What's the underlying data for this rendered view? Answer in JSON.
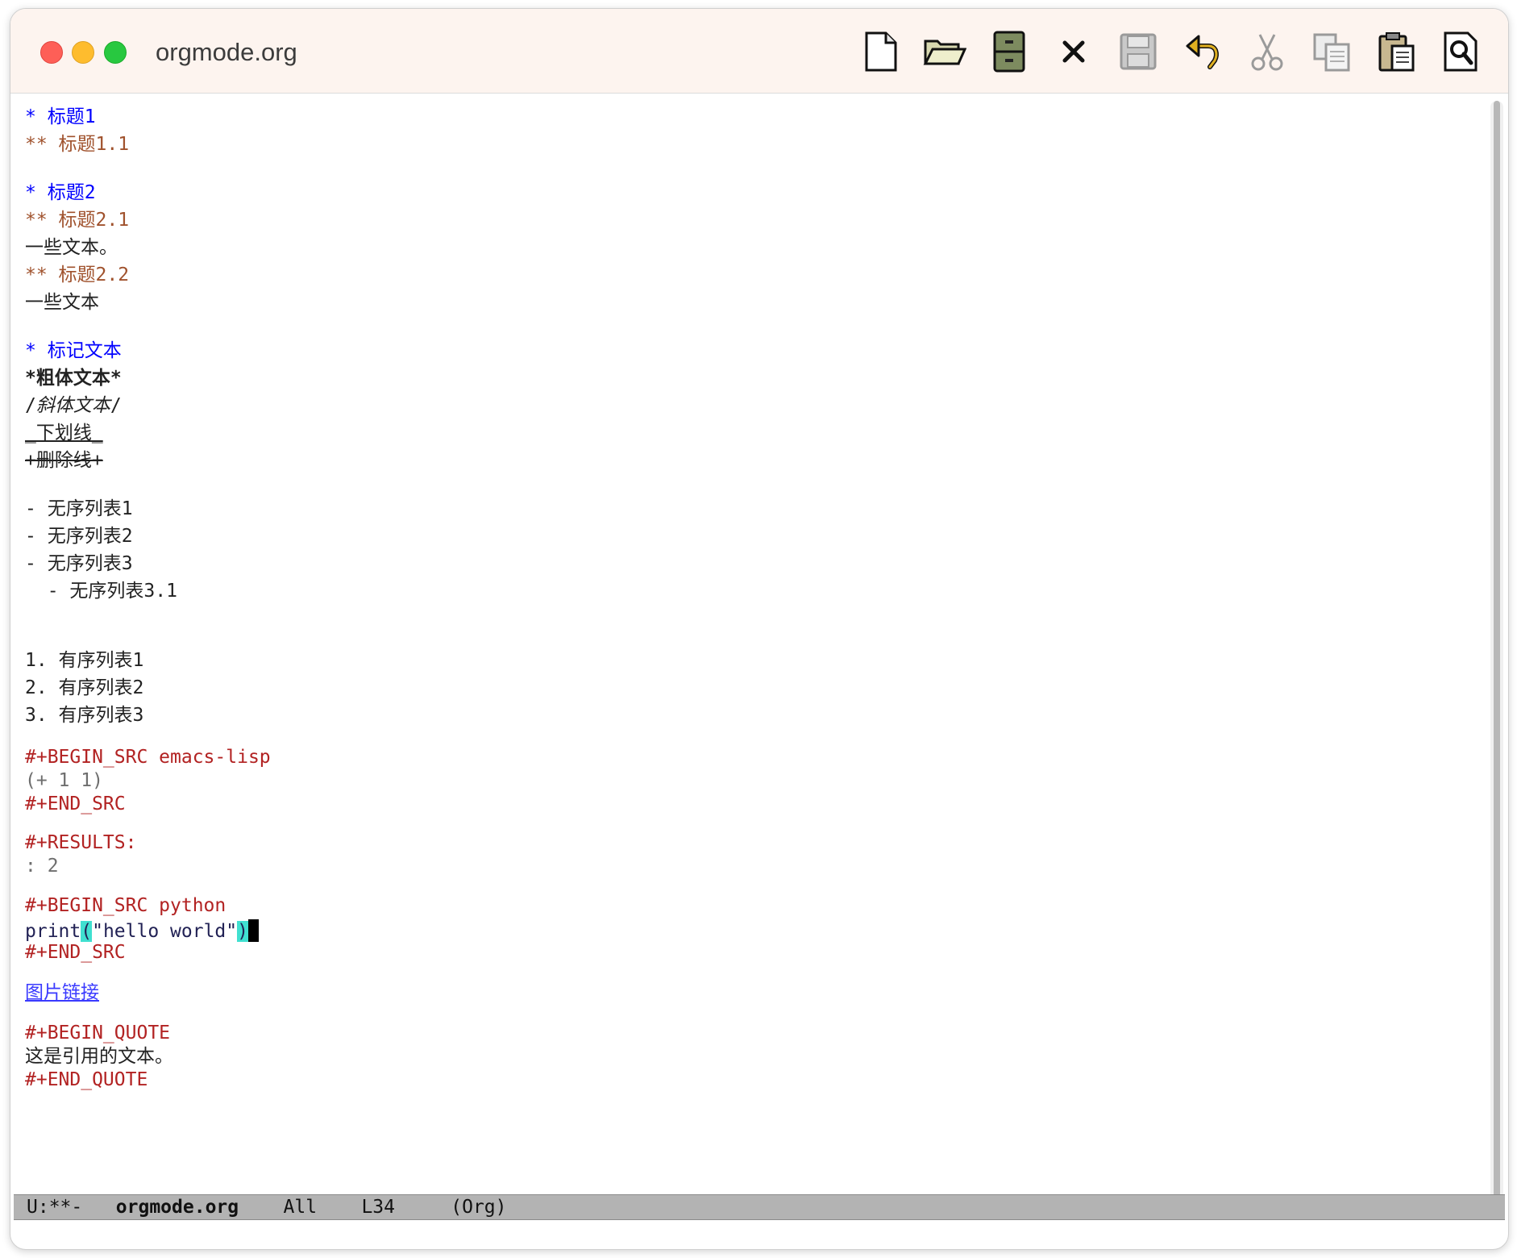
{
  "window": {
    "title": "orgmode.org"
  },
  "toolbar": {
    "items": [
      {
        "name": "new-file-icon"
      },
      {
        "name": "open-folder-icon"
      },
      {
        "name": "dired-cabinet-icon"
      },
      {
        "name": "close-buffer-icon"
      },
      {
        "name": "save-icon"
      },
      {
        "name": "undo-icon"
      },
      {
        "name": "cut-icon"
      },
      {
        "name": "copy-icon"
      },
      {
        "name": "paste-icon"
      },
      {
        "name": "search-icon"
      }
    ]
  },
  "buffer": {
    "h1_1": "* 标题1",
    "h2_1_1": "** 标题1.1",
    "h1_2": "* 标题2",
    "h2_2_1": "** 标题2.1",
    "text_2_1": "一些文本。",
    "h2_2_2": "** 标题2.2",
    "text_2_2": "一些文本",
    "h1_markup": "* 标记文本",
    "bold": "*粗体文本*",
    "italic_slash_open": "/",
    "italic_text": "斜体文本",
    "italic_slash_close": "/",
    "underline": "_下划线_",
    "strike": "+删除线+",
    "ul": [
      "- 无序列表1",
      "- 无序列表2",
      "- 无序列表3"
    ],
    "ul_nested": "  - 无序列表3.1",
    "ol": [
      "1. 有序列表1",
      "2. 有序列表2",
      "3. 有序列表3"
    ],
    "src1_begin": "#+BEGIN_SRC emacs-lisp",
    "src1_body": "(+ 1 1)",
    "src1_end": "#+END_SRC",
    "results": "#+RESULTS:",
    "results_value": ": 2",
    "src2_begin": "#+BEGIN_SRC python",
    "src2_print": "print",
    "src2_lparen": "(",
    "src2_string": "\"hello world\"",
    "src2_rparen": ")",
    "src2_end": "#+END_SRC",
    "image_link": "图片链接",
    "quote_begin": "#+BEGIN_QUOTE",
    "quote_text": "这是引用的文本。",
    "quote_end": "#+END_QUOTE"
  },
  "modeline": {
    "status": "U:**-",
    "buffer_name": "orgmode.org",
    "position": "All",
    "line": "L34",
    "mode": "(Org)"
  }
}
